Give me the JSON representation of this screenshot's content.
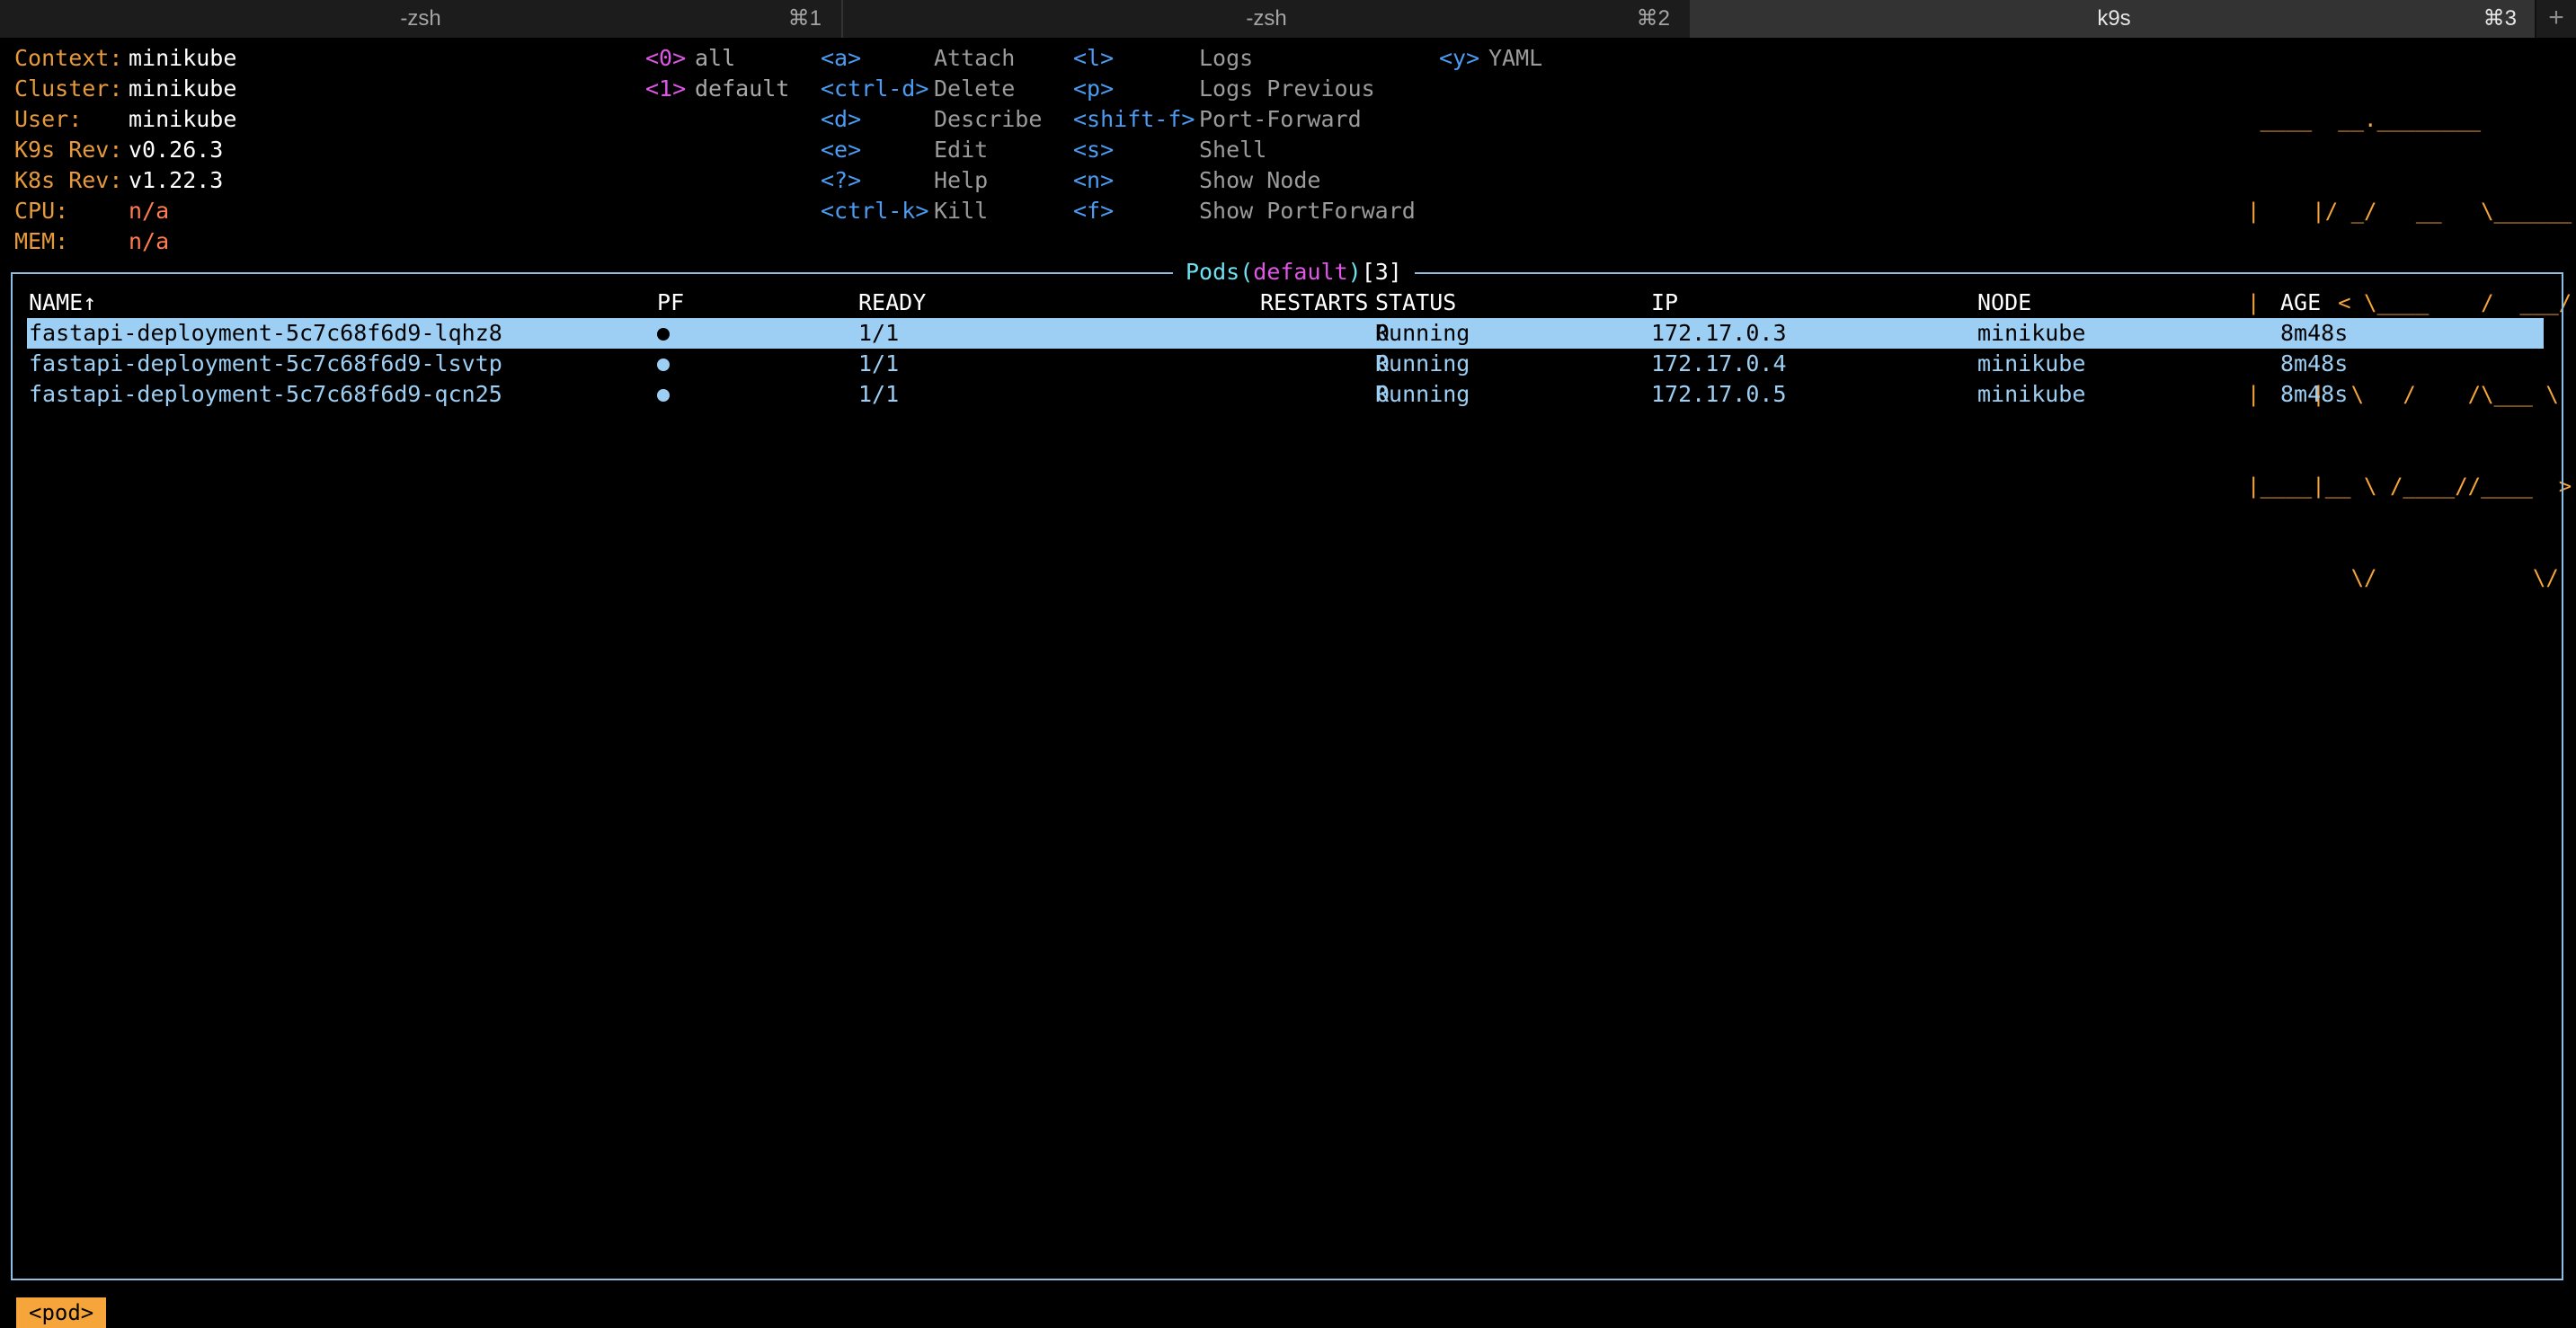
{
  "tabs": [
    {
      "title": "-zsh",
      "key": "⌘1"
    },
    {
      "title": "-zsh",
      "key": "⌘2"
    },
    {
      "title": "k9s",
      "key": "⌘3"
    }
  ],
  "tab_add": "+",
  "info": {
    "context_label": "Context:",
    "context": "minikube",
    "cluster_label": "Cluster:",
    "cluster": "minikube",
    "user_label": "User:",
    "user": "minikube",
    "k9s_rev_label": "K9s Rev:",
    "k9s_rev": "v0.26.3",
    "k8s_rev_label": "K8s Rev:",
    "k8s_rev": "v1.22.3",
    "cpu_label": "CPU:",
    "cpu": "n/a",
    "mem_label": "MEM:",
    "mem": "n/a"
  },
  "namespaces": [
    {
      "key": "<0>",
      "name": "all"
    },
    {
      "key": "<1>",
      "name": "default"
    }
  ],
  "hotkeys_col1": [
    {
      "key": "<a>",
      "label": "Attach"
    },
    {
      "key": "<ctrl-d>",
      "label": "Delete"
    },
    {
      "key": "<d>",
      "label": "Describe"
    },
    {
      "key": "<e>",
      "label": "Edit"
    },
    {
      "key": "<?>",
      "label": "Help"
    },
    {
      "key": "<ctrl-k>",
      "label": "Kill"
    }
  ],
  "hotkeys_col2": [
    {
      "key": "<l>",
      "label": "Logs"
    },
    {
      "key": "<p>",
      "label": "Logs Previous"
    },
    {
      "key": "<shift-f>",
      "label": "Port-Forward"
    },
    {
      "key": "<s>",
      "label": "Shell"
    },
    {
      "key": "<n>",
      "label": "Show Node"
    },
    {
      "key": "<f>",
      "label": "Show PortForward"
    }
  ],
  "hotkeys_col3": [
    {
      "key": "<y>",
      "label": "YAML"
    }
  ],
  "logo_lines": [
    " ____  __.________       ",
    "|    |/ _/   __   \\______",
    "|      < \\____    /  ___/",
    "|    |  \\   /    /\\___ \\ ",
    "|____|__ \\ /____//____  >",
    "        \\/            \\/ "
  ],
  "table": {
    "title_resource": "Pods",
    "title_open": "(",
    "title_namespace": "default",
    "title_close": ")",
    "title_count": "[3]",
    "headers": {
      "name": "NAME↑",
      "pf": "PF",
      "ready": "READY",
      "restarts": "RESTARTS",
      "status": "STATUS",
      "ip": "IP",
      "node": "NODE",
      "age": "AGE"
    },
    "rows": [
      {
        "name": "fastapi-deployment-5c7c68f6d9-lqhz8",
        "pf": "●",
        "ready": "1/1",
        "restarts": "0",
        "status": "Running",
        "ip": "172.17.0.3",
        "node": "minikube",
        "age": "8m48s"
      },
      {
        "name": "fastapi-deployment-5c7c68f6d9-lsvtp",
        "pf": "●",
        "ready": "1/1",
        "restarts": "0",
        "status": "Running",
        "ip": "172.17.0.4",
        "node": "minikube",
        "age": "8m48s"
      },
      {
        "name": "fastapi-deployment-5c7c68f6d9-qcn25",
        "pf": "●",
        "ready": "1/1",
        "restarts": "0",
        "status": "Running",
        "ip": "172.17.0.5",
        "node": "minikube",
        "age": "8m48s"
      }
    ]
  },
  "breadcrumb": "<pod>",
  "colors": {
    "background": "#000000",
    "label_orange": "#e69a3c",
    "hotkey_blue": "#4b9cf2",
    "namespace_magenta": "#e057e7",
    "table_text": "#9dcff4",
    "frame_title": "#6de2f0",
    "logo": "#f6a53a",
    "na_red": "#ff7b50"
  }
}
